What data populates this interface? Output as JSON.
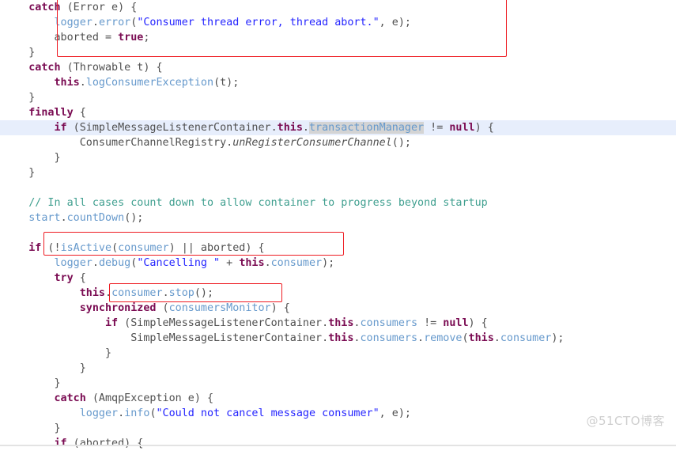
{
  "editor": {
    "language": "java",
    "highlighted_line_index": 8,
    "colors": {
      "background": "#ffffff",
      "keyword": "#7a0b52",
      "string": "#2424ff",
      "identifier": "#6699cc",
      "comment": "#3f9f8f",
      "plain": "#4f4f4f",
      "current_line_highlight": "#e7eefc",
      "selection_highlight": "#d4d4d4",
      "annotation_box": "#ee1c23",
      "watermark": "#cfcfcf"
    },
    "lines": [
      {
        "indent": 1,
        "tokens": [
          {
            "t": "kw",
            "v": "catch"
          },
          {
            "t": "pl",
            "v": " (Error e) {"
          }
        ]
      },
      {
        "indent": 2,
        "tokens": [
          {
            "t": "id",
            "v": "logger"
          },
          {
            "t": "pl",
            "v": "."
          },
          {
            "t": "id",
            "v": "error"
          },
          {
            "t": "pl",
            "v": "("
          },
          {
            "t": "str",
            "v": "\"Consumer thread error, thread abort.\""
          },
          {
            "t": "pl",
            "v": ", e);"
          }
        ]
      },
      {
        "indent": 2,
        "tokens": [
          {
            "t": "pl",
            "v": "aborted = "
          },
          {
            "t": "kw",
            "v": "true"
          },
          {
            "t": "pl",
            "v": ";"
          }
        ]
      },
      {
        "indent": 1,
        "tokens": [
          {
            "t": "pl",
            "v": "}"
          }
        ]
      },
      {
        "indent": 1,
        "tokens": [
          {
            "t": "kw",
            "v": "catch"
          },
          {
            "t": "pl",
            "v": " (Throwable t) {"
          }
        ]
      },
      {
        "indent": 2,
        "tokens": [
          {
            "t": "kw",
            "v": "this"
          },
          {
            "t": "pl",
            "v": "."
          },
          {
            "t": "id",
            "v": "logConsumerException"
          },
          {
            "t": "pl",
            "v": "(t);"
          }
        ]
      },
      {
        "indent": 1,
        "tokens": [
          {
            "t": "pl",
            "v": "}"
          }
        ]
      },
      {
        "indent": 1,
        "tokens": [
          {
            "t": "kw",
            "v": "finally"
          },
          {
            "t": "pl",
            "v": " {"
          }
        ]
      },
      {
        "indent": 2,
        "highlight": true,
        "tokens": [
          {
            "t": "kw",
            "v": "if"
          },
          {
            "t": "pl",
            "v": " (SimpleMessageListenerContainer."
          },
          {
            "t": "kw",
            "v": "this"
          },
          {
            "t": "pl",
            "v": "."
          },
          {
            "t": "sel",
            "v": "transactionManager"
          },
          {
            "t": "pl",
            "v": " != "
          },
          {
            "t": "kw",
            "v": "null"
          },
          {
            "t": "pl",
            "v": ") {"
          }
        ]
      },
      {
        "indent": 3,
        "tokens": [
          {
            "t": "pl",
            "v": "ConsumerChannelRegistry."
          },
          {
            "t": "st",
            "v": "unRegisterConsumerChannel"
          },
          {
            "t": "pl",
            "v": "();"
          }
        ]
      },
      {
        "indent": 2,
        "tokens": [
          {
            "t": "pl",
            "v": "}"
          }
        ]
      },
      {
        "indent": 1,
        "tokens": [
          {
            "t": "pl",
            "v": "}"
          }
        ]
      },
      {
        "indent": 0,
        "tokens": []
      },
      {
        "indent": 1,
        "tokens": [
          {
            "t": "cm",
            "v": "// In all cases count down to allow container to progress beyond startup"
          }
        ]
      },
      {
        "indent": 1,
        "tokens": [
          {
            "t": "id",
            "v": "start"
          },
          {
            "t": "pl",
            "v": "."
          },
          {
            "t": "id",
            "v": "countDown"
          },
          {
            "t": "pl",
            "v": "();"
          }
        ]
      },
      {
        "indent": 0,
        "tokens": []
      },
      {
        "indent": 1,
        "tokens": [
          {
            "t": "kw",
            "v": "if"
          },
          {
            "t": "pl",
            "v": " (!"
          },
          {
            "t": "id",
            "v": "isActive"
          },
          {
            "t": "pl",
            "v": "("
          },
          {
            "t": "id",
            "v": "consumer"
          },
          {
            "t": "pl",
            "v": ") || aborted) {"
          }
        ]
      },
      {
        "indent": 2,
        "tokens": [
          {
            "t": "id",
            "v": "logger"
          },
          {
            "t": "pl",
            "v": "."
          },
          {
            "t": "id",
            "v": "debug"
          },
          {
            "t": "pl",
            "v": "("
          },
          {
            "t": "str",
            "v": "\"Cancelling \""
          },
          {
            "t": "pl",
            "v": " + "
          },
          {
            "t": "kw",
            "v": "this"
          },
          {
            "t": "pl",
            "v": "."
          },
          {
            "t": "id",
            "v": "consumer"
          },
          {
            "t": "pl",
            "v": ");"
          }
        ]
      },
      {
        "indent": 2,
        "tokens": [
          {
            "t": "kw",
            "v": "try"
          },
          {
            "t": "pl",
            "v": " {"
          }
        ]
      },
      {
        "indent": 3,
        "tokens": [
          {
            "t": "kw",
            "v": "this"
          },
          {
            "t": "pl",
            "v": "."
          },
          {
            "t": "id",
            "v": "consumer"
          },
          {
            "t": "pl",
            "v": "."
          },
          {
            "t": "id",
            "v": "stop"
          },
          {
            "t": "pl",
            "v": "();"
          }
        ]
      },
      {
        "indent": 3,
        "tokens": [
          {
            "t": "kw",
            "v": "synchronized"
          },
          {
            "t": "pl",
            "v": " ("
          },
          {
            "t": "id",
            "v": "consumersMonitor"
          },
          {
            "t": "pl",
            "v": ") {"
          }
        ]
      },
      {
        "indent": 4,
        "tokens": [
          {
            "t": "kw",
            "v": "if"
          },
          {
            "t": "pl",
            "v": " (SimpleMessageListenerContainer."
          },
          {
            "t": "kw",
            "v": "this"
          },
          {
            "t": "pl",
            "v": "."
          },
          {
            "t": "id",
            "v": "consumers"
          },
          {
            "t": "pl",
            "v": " != "
          },
          {
            "t": "kw",
            "v": "null"
          },
          {
            "t": "pl",
            "v": ") {"
          }
        ]
      },
      {
        "indent": 5,
        "tokens": [
          {
            "t": "pl",
            "v": "SimpleMessageListenerContainer."
          },
          {
            "t": "kw",
            "v": "this"
          },
          {
            "t": "pl",
            "v": "."
          },
          {
            "t": "id",
            "v": "consumers"
          },
          {
            "t": "pl",
            "v": "."
          },
          {
            "t": "id",
            "v": "remove"
          },
          {
            "t": "pl",
            "v": "("
          },
          {
            "t": "kw",
            "v": "this"
          },
          {
            "t": "pl",
            "v": "."
          },
          {
            "t": "id",
            "v": "consumer"
          },
          {
            "t": "pl",
            "v": ");"
          }
        ]
      },
      {
        "indent": 4,
        "tokens": [
          {
            "t": "pl",
            "v": "}"
          }
        ]
      },
      {
        "indent": 3,
        "tokens": [
          {
            "t": "pl",
            "v": "}"
          }
        ]
      },
      {
        "indent": 2,
        "tokens": [
          {
            "t": "pl",
            "v": "}"
          }
        ]
      },
      {
        "indent": 2,
        "tokens": [
          {
            "t": "kw",
            "v": "catch"
          },
          {
            "t": "pl",
            "v": " (AmqpException e) {"
          }
        ]
      },
      {
        "indent": 3,
        "tokens": [
          {
            "t": "id",
            "v": "logger"
          },
          {
            "t": "pl",
            "v": "."
          },
          {
            "t": "id",
            "v": "info"
          },
          {
            "t": "pl",
            "v": "("
          },
          {
            "t": "str",
            "v": "\"Could not cancel message consumer\""
          },
          {
            "t": "pl",
            "v": ", e);"
          }
        ]
      },
      {
        "indent": 2,
        "tokens": [
          {
            "t": "pl",
            "v": "}"
          }
        ]
      },
      {
        "indent": 2,
        "tokens": [
          {
            "t": "kw",
            "v": "if"
          },
          {
            "t": "pl",
            "v": " (aborted) {"
          }
        ]
      }
    ],
    "annotations": [
      {
        "id": "rbox1",
        "label": "error-catch-block-annotation"
      },
      {
        "id": "rbox2",
        "label": "inactive-consumer-check-annotation"
      },
      {
        "id": "rbox3",
        "label": "consumer-stop-annotation"
      }
    ]
  },
  "watermark": {
    "text": "@51CTO博客"
  }
}
